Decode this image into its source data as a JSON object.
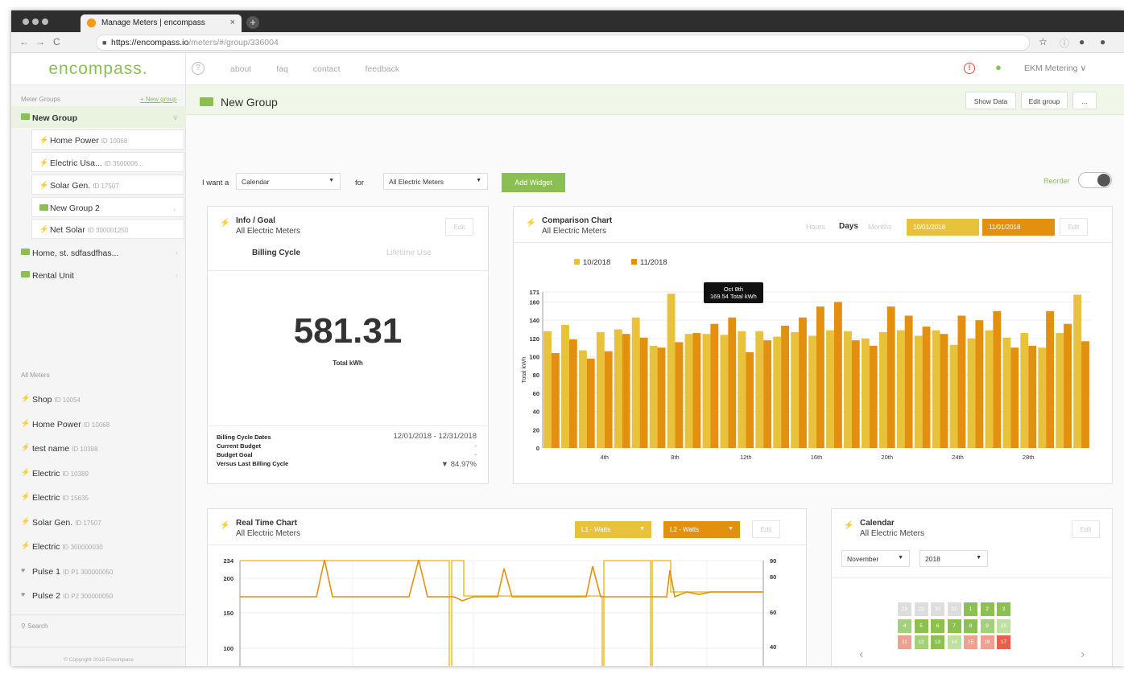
{
  "browser": {
    "tab_title": "Manage Meters | encompass",
    "tab_close": "×",
    "new_tab": "+",
    "url_host": "https://encompass.io",
    "url_path": "/meters/#/group/336004"
  },
  "topbar": {
    "logo": "encompass.",
    "help_icon": "?",
    "nav": [
      "about",
      "faq",
      "contact",
      "feedback"
    ],
    "account": "EKM Metering"
  },
  "sidebar": {
    "groups_header": "Meter Groups",
    "groups_link": "+ New group",
    "groups": [
      {
        "label": "New Group",
        "kind": "group",
        "icon": "folder-icon"
      },
      {
        "label": "Home Power",
        "id": "ID 10068",
        "kind": "sub",
        "icon": "bolt-icon"
      },
      {
        "label": "Electric Usa...",
        "id": "ID 3500006...",
        "kind": "sub",
        "icon": "bolt-icon"
      },
      {
        "label": "Solar Gen.",
        "id": "ID 17507",
        "kind": "sub",
        "icon": "bolt-icon"
      },
      {
        "label": "New Group 2",
        "kind": "subgroup",
        "icon": "folder-icon"
      },
      {
        "label": "Net Solar",
        "id": "ID 300001250",
        "kind": "sub",
        "icon": "bolt-icon"
      },
      {
        "label": "Home, st. sdfasdfhas...",
        "kind": "folder",
        "icon": "folder-icon"
      },
      {
        "label": "Rental Unit",
        "kind": "folder",
        "icon": "folder-icon"
      }
    ],
    "meters_header": "All Meters",
    "meters": [
      {
        "label": "Shop",
        "id": "ID 10054"
      },
      {
        "label": "Home Power",
        "id": "ID 10068"
      },
      {
        "label": "test name",
        "id": "ID 10388"
      },
      {
        "label": "Electric",
        "id": "ID 10389"
      },
      {
        "label": "Electric",
        "id": "ID 15635"
      },
      {
        "label": "Solar Gen.",
        "id": "ID 17507"
      },
      {
        "label": "Electric",
        "id": "ID 300000030"
      },
      {
        "label": "Pulse 1",
        "id": "ID P1 300000050"
      },
      {
        "label": "Pulse 2",
        "id": "ID P2 300000050"
      }
    ],
    "search_placeholder": "Search",
    "copyright": "© Copyright 2018 Encompass"
  },
  "group": {
    "title": "New Group",
    "show_data": "Show Data",
    "edit_group": "Edit group",
    "more": "..."
  },
  "widget_builder": {
    "i_want_a": "I want a",
    "type_value": "Calendar",
    "for": "for",
    "meters_value": "All Electric Meters",
    "add_widget": "Add Widget",
    "reorder": "Reorder"
  },
  "info_card": {
    "title": "Info / Goal",
    "subtitle": "All Electric Meters",
    "edit": "Edit",
    "tab_billing": "Billing Cycle",
    "tab_lifetime": "Lifetime Use",
    "value": "581.31",
    "unit": "Total kWh",
    "rows": [
      {
        "label": "Billing Cycle Dates",
        "value": "12/01/2018 - 12/31/2018"
      },
      {
        "label": "Current Budget",
        "value": "-"
      },
      {
        "label": "Budget Goal",
        "value": "-"
      },
      {
        "label": "Versus Last Billing Cycle",
        "value": "▼ 84.97%"
      }
    ]
  },
  "comparison_card": {
    "title": "Comparison Chart",
    "subtitle": "All Electric Meters",
    "range_hours": "Hours",
    "range_days": "Days",
    "range_months": "Months",
    "date1": "10/01/2018",
    "date2": "11/01/2018",
    "edit": "Edit",
    "tooltip_line1": "Oct 8th",
    "tooltip_line2": "169.54 Total kWh",
    "colors": {
      "oct": "#e8c23a",
      "nov": "#e3900f"
    }
  },
  "chart_data": {
    "type": "bar",
    "ylabel": "Total kWh",
    "ylim": [
      0,
      171
    ],
    "yticks": [
      0,
      20,
      40,
      60,
      80,
      100,
      120,
      140,
      160,
      171
    ],
    "x": [
      1,
      2,
      3,
      4,
      5,
      6,
      7,
      8,
      9,
      10,
      11,
      12,
      13,
      14,
      15,
      16,
      17,
      18,
      19,
      20,
      21,
      22,
      23,
      24,
      25,
      26,
      27,
      28,
      29,
      30,
      31
    ],
    "xtick_labels": {
      "4": "4th",
      "8": "8th",
      "12": "12th",
      "16": "16th",
      "20": "20th",
      "24": "24th",
      "28": "28th"
    },
    "series": [
      {
        "name": "10/2018",
        "values": [
          128,
          135,
          107,
          127,
          130,
          143,
          112,
          169,
          125,
          125,
          124,
          128,
          128,
          122,
          127,
          123,
          129,
          128,
          120,
          127,
          129,
          123,
          129,
          113,
          120,
          129,
          121,
          126,
          110,
          126,
          168
        ]
      },
      {
        "name": "11/2018",
        "values": [
          104,
          119,
          98,
          106,
          125,
          121,
          110,
          116,
          126,
          136,
          143,
          105,
          118,
          134,
          143,
          155,
          160,
          118,
          112,
          155,
          145,
          133,
          125,
          145,
          140,
          150,
          110,
          112,
          150,
          136,
          117
        ]
      }
    ]
  },
  "realtime_card": {
    "title": "Real Time Chart",
    "subtitle": "All Electric Meters",
    "l1": "L1 - Watts",
    "l2": "L2 - Watts",
    "edit": "Edit",
    "left_ticks": [
      "234",
      "200",
      "150",
      "100"
    ],
    "right_ticks": [
      "90",
      "80",
      "60",
      "40"
    ]
  },
  "calendar_card": {
    "title": "Calendar",
    "subtitle": "All Electric Meters",
    "edit": "Edit",
    "month": "November",
    "year": "2018",
    "prev": "‹",
    "next": "›",
    "rows": [
      [
        {
          "d": "28",
          "c": "#ddd"
        },
        {
          "d": "29",
          "c": "#ddd"
        },
        {
          "d": "30",
          "c": "#ddd"
        },
        {
          "d": "31",
          "c": "#ddd"
        },
        {
          "d": "1",
          "c": "#8cc152"
        },
        {
          "d": "2",
          "c": "#8cc152"
        },
        {
          "d": "3",
          "c": "#8cc152"
        }
      ],
      [
        {
          "d": "4",
          "c": "#a5d07a"
        },
        {
          "d": "5",
          "c": "#8cc152"
        },
        {
          "d": "6",
          "c": "#8cc152"
        },
        {
          "d": "7",
          "c": "#8cc152"
        },
        {
          "d": "8",
          "c": "#8cc152"
        },
        {
          "d": "9",
          "c": "#a5d07a"
        },
        {
          "d": "10",
          "c": "#bfe0a0"
        }
      ],
      [
        {
          "d": "11",
          "c": "#f0a090"
        },
        {
          "d": "12",
          "c": "#a5d07a"
        },
        {
          "d": "13",
          "c": "#8cc152"
        },
        {
          "d": "14",
          "c": "#bfe0a0"
        },
        {
          "d": "15",
          "c": "#f0a090"
        },
        {
          "d": "16",
          "c": "#f0a090"
        },
        {
          "d": "17",
          "c": "#e8604c"
        }
      ]
    ]
  }
}
